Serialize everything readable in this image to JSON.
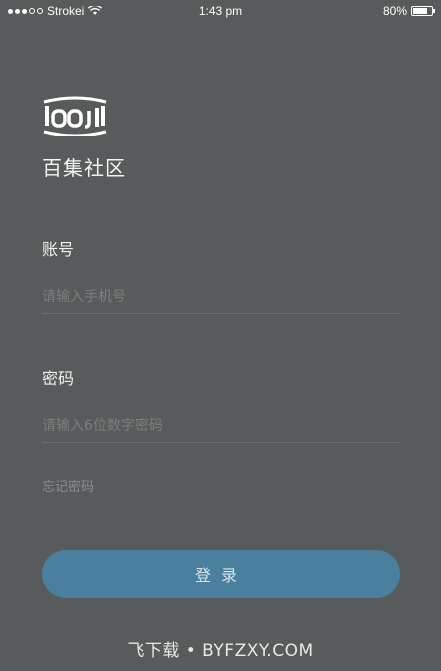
{
  "status_bar": {
    "carrier": "Strokei",
    "time": "1:43 pm",
    "battery_percent": "80%",
    "battery_level": 0.8
  },
  "app": {
    "logo_text": "looji",
    "name": "百集社区"
  },
  "account": {
    "label": "账号",
    "placeholder": "请输入手机号",
    "value": ""
  },
  "password": {
    "label": "密码",
    "placeholder": "请输入6位数字密码",
    "value": ""
  },
  "forgot_password": "忘记密码",
  "login_button": "登录",
  "watermark": "飞下载 • BYFZXY.COM",
  "colors": {
    "background": "#585b5b",
    "button": "#4a7f9e"
  }
}
